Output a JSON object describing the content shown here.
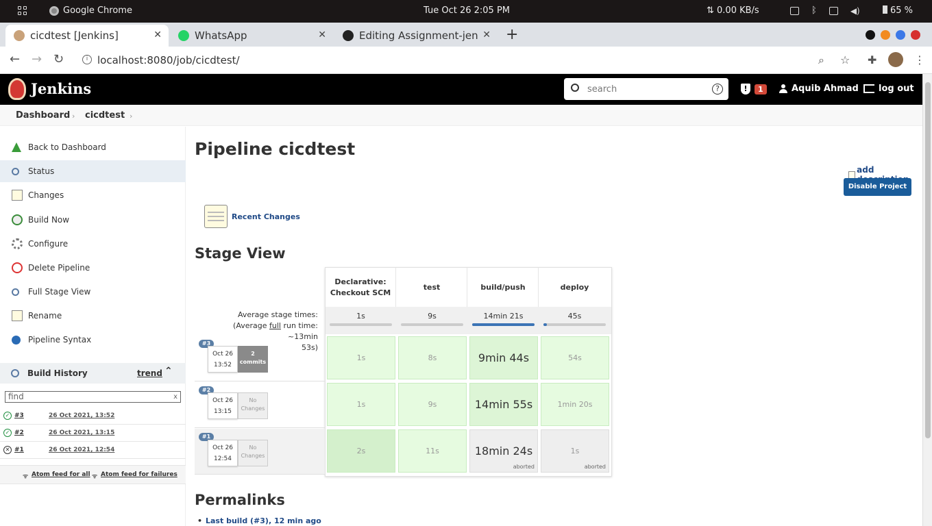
{
  "os": {
    "app_name": "Google Chrome",
    "clock": "Tue Oct 26   2:05 PM",
    "network": "⇅ 0.00 KB/s",
    "battery": "65 %"
  },
  "browser": {
    "tabs": [
      {
        "label": "cicdtest [Jenkins]",
        "close": "✕"
      },
      {
        "label": "WhatsApp",
        "close": "✕"
      },
      {
        "label": "Editing Assignment-jen",
        "close": "✕"
      }
    ],
    "new_tab": "+",
    "url": "localhost:8080/job/cicdtest/"
  },
  "jenkins": {
    "title": "Jenkins",
    "search_placeholder": "search",
    "help": "?",
    "alert_mark": "!",
    "alert_count": "1",
    "user": "Aquib Ahmad",
    "logout": "log out"
  },
  "breadcrumb": {
    "items": [
      "Dashboard",
      "cicdtest"
    ],
    "sep": "›"
  },
  "sidebar": {
    "tasks": [
      {
        "label": "Back to Dashboard",
        "icon": "up-arrow-icon"
      },
      {
        "label": "Status",
        "icon": "search-icon"
      },
      {
        "label": "Changes",
        "icon": "notepad-icon"
      },
      {
        "label": "Build Now",
        "icon": "clock-icon"
      },
      {
        "label": "Configure",
        "icon": "gear-icon"
      },
      {
        "label": "Delete Pipeline",
        "icon": "no-entry-icon"
      },
      {
        "label": "Full Stage View",
        "icon": "search-icon"
      },
      {
        "label": "Rename",
        "icon": "notepad-icon"
      },
      {
        "label": "Pipeline Syntax",
        "icon": "help-icon"
      }
    ],
    "build_history": {
      "title": "Build History",
      "trend": "trend",
      "collapse": "⌃",
      "find_placeholder": "find",
      "find_clear": "x",
      "builds": [
        {
          "num": "#3",
          "date": "26 Oct 2021, 13:52",
          "status": "success",
          "mark": "✓"
        },
        {
          "num": "#2",
          "date": "26 Oct 2021, 13:15",
          "status": "success",
          "mark": "✓"
        },
        {
          "num": "#1",
          "date": "26 Oct 2021, 12:54",
          "status": "aborted",
          "mark": "✕"
        }
      ],
      "feed_all": "Atom feed for all",
      "feed_failures": "Atom feed for failures"
    }
  },
  "main": {
    "title": "Pipeline cicdtest",
    "add_description": "add description",
    "disable_button": "Disable Project",
    "recent_changes": "Recent Changes",
    "stage_view_title": "Stage View",
    "permalinks_title": "Permalinks",
    "permalink_first": "Last build (#3), 12 min ago"
  },
  "stage_view": {
    "stages": [
      "Declarative: Checkout SCM",
      "test",
      "build/push",
      "deploy"
    ],
    "avg_label_1": "Average stage times:",
    "avg_label_2a": "(Average ",
    "avg_label_2b": "full",
    "avg_label_2c": " run time: ~13min",
    "avg_label_3": "53s)",
    "avg_times": [
      "1s",
      "9s",
      "14min 21s",
      "45s"
    ],
    "avg_fill": [
      0.0,
      0.0,
      1.0,
      0.05
    ],
    "runs": [
      {
        "badge": "#3",
        "date": "Oct 26",
        "time": "13:52",
        "changes_1": "2",
        "changes_2": "commits",
        "cells": [
          "1s",
          "8s",
          "9min 44s",
          "54s"
        ],
        "notes": [
          "",
          "",
          "",
          ""
        ]
      },
      {
        "badge": "#2",
        "date": "Oct 26",
        "time": "13:15",
        "changes_1": "No",
        "changes_2": "Changes",
        "cells": [
          "1s",
          "9s",
          "14min 55s",
          "1min 20s"
        ],
        "notes": [
          "",
          "",
          "",
          ""
        ]
      },
      {
        "badge": "#1",
        "date": "Oct 26",
        "time": "12:54",
        "changes_1": "No",
        "changes_2": "Changes",
        "cells": [
          "2s",
          "11s",
          "18min 24s",
          "1s"
        ],
        "notes": [
          "",
          "",
          "aborted",
          "aborted"
        ]
      }
    ]
  }
}
